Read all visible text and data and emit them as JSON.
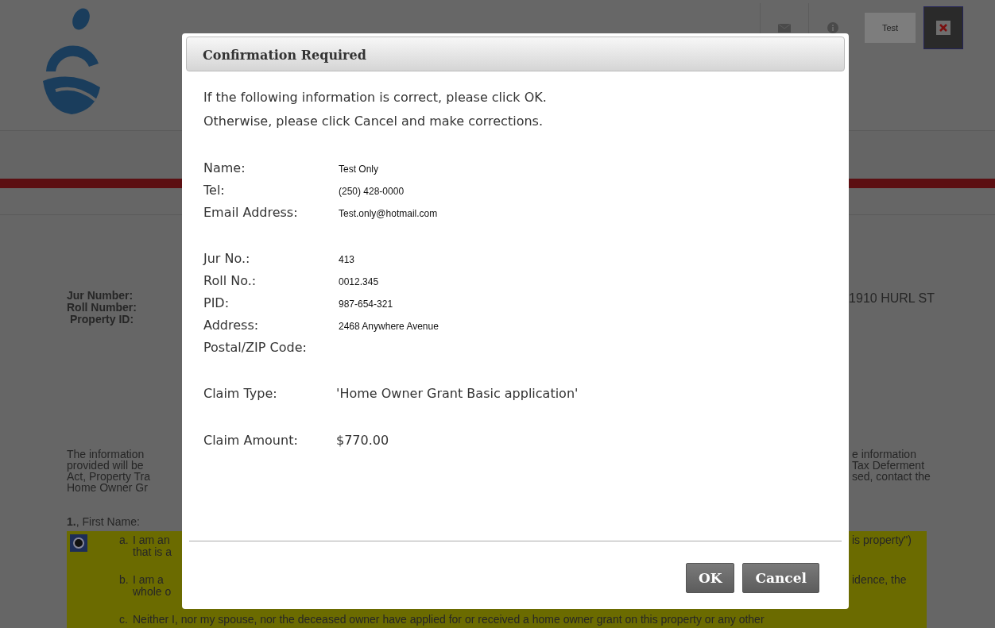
{
  "header": {
    "user_button": "Test"
  },
  "property": {
    "labels": [
      "Jur Number:",
      "Roll Number:",
      "Property ID:"
    ],
    "address": "1910 HURL ST"
  },
  "notice": {
    "left": [
      "The information",
      "provided will be",
      "Act, Property Tra",
      "Home Owner Gr"
    ],
    "right": [
      "e information",
      "Tax Deferment",
      "sed, contact the"
    ]
  },
  "question": {
    "number": "1.",
    "label": ", First Name:"
  },
  "options": [
    {
      "letter": "a.",
      "selected": true,
      "left": [
        "I am an",
        "that is a"
      ],
      "right": [
        "is property\")"
      ]
    },
    {
      "letter": "b.",
      "selected": false,
      "left": [
        "I am a",
        "whole o"
      ],
      "right": [
        "idence, the"
      ]
    },
    {
      "letter": "c.",
      "selected": false,
      "left": [
        "Neither I, nor my spouse, nor the deceased owner have applied for or received a home owner grant on this property or any other"
      ]
    }
  ],
  "dialog": {
    "title": "Confirmation Required",
    "intro": [
      "If the following information is correct, please click OK.",
      "Otherwise, please click Cancel and make corrections."
    ],
    "groups": [
      [
        {
          "label": "Name:",
          "value": "Test Only"
        },
        {
          "label": "Tel:",
          "value": "(250) 428-0000"
        },
        {
          "label": "Email Address:",
          "value": "Test.only@hotmail.com"
        }
      ],
      [
        {
          "label": "Jur No.:",
          "value": "413"
        },
        {
          "label": "Roll No.:",
          "value": "0012.345"
        },
        {
          "label": "PID:",
          "value": "987-654-321"
        },
        {
          "label": "Address:",
          "value": "2468 Anywhere Avenue"
        },
        {
          "label": "Postal/ZIP Code:"
        }
      ]
    ],
    "claims": [
      {
        "label": "Claim Type:",
        "value": "'Home Owner Grant Basic application'"
      },
      {
        "label": "Claim Amount:",
        "value": "$770.00"
      }
    ],
    "buttons": [
      "OK",
      "Cancel"
    ]
  }
}
